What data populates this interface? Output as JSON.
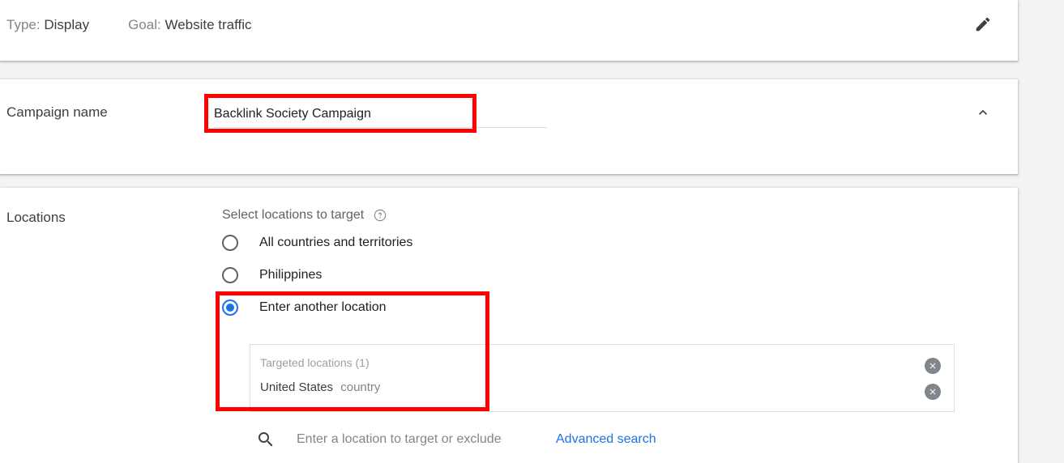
{
  "header": {
    "type_label": "Type:",
    "type_value": "Display",
    "goal_label": "Goal:",
    "goal_value": "Website traffic",
    "edit_icon": "pencil-icon"
  },
  "campaign": {
    "label": "Campaign name",
    "value": "Backlink Society Campaign",
    "placeholder": "Campaign name",
    "collapse_icon": "chevron-up-icon"
  },
  "locations": {
    "label": "Locations",
    "select_prompt": "Select locations to target",
    "help_icon": "help-circle-icon",
    "collapse_icon": "chevron-up-icon",
    "options": [
      {
        "label": "All countries and territories",
        "selected": false
      },
      {
        "label": "Philippines",
        "selected": false
      },
      {
        "label": "Enter another location",
        "selected": true
      }
    ],
    "targeted": {
      "title": "Targeted locations (1)",
      "items": [
        {
          "name": "United States",
          "type": "country",
          "remove_icon": "remove-circle-icon"
        }
      ],
      "extra_remove_icon": "remove-circle-icon"
    },
    "search": {
      "icon": "search-icon",
      "placeholder": "Enter a location to target or exclude",
      "value": "",
      "advanced_link": "Advanced search"
    }
  },
  "colors": {
    "accent_blue": "#1a73e8",
    "annotation_red": "#ff0000",
    "page_background": "#f1f3f4"
  }
}
